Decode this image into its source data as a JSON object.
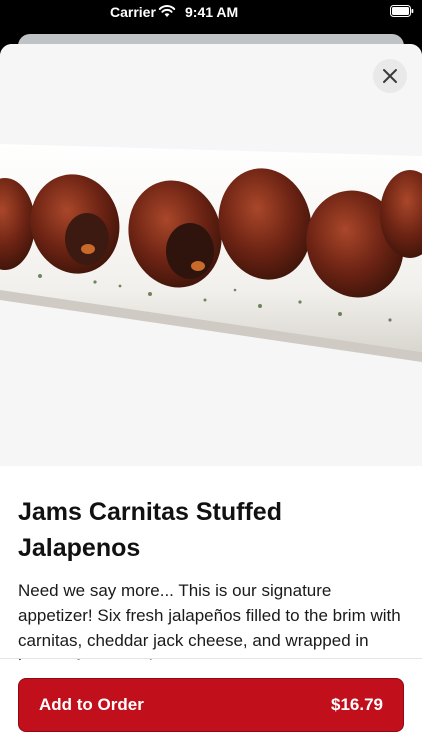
{
  "status_bar": {
    "carrier": "Carrier",
    "time": "9:41 AM"
  },
  "item": {
    "title": "Jams Carnitas Stuffed Jalapenos",
    "description": "Need we say more... This is our signature appetizer! Six fresh jalapeños filled to the brim with carnitas, cheddar jack cheese, and wrapped in bacon. A must try!"
  },
  "actions": {
    "add_label": "Add to Order",
    "price": "$16.79"
  },
  "colors": {
    "accent": "#c20f1c",
    "close_bg": "#e9e9ea"
  },
  "icons": {
    "close": "close-icon",
    "wifi": "wifi-icon",
    "battery": "battery-icon"
  }
}
